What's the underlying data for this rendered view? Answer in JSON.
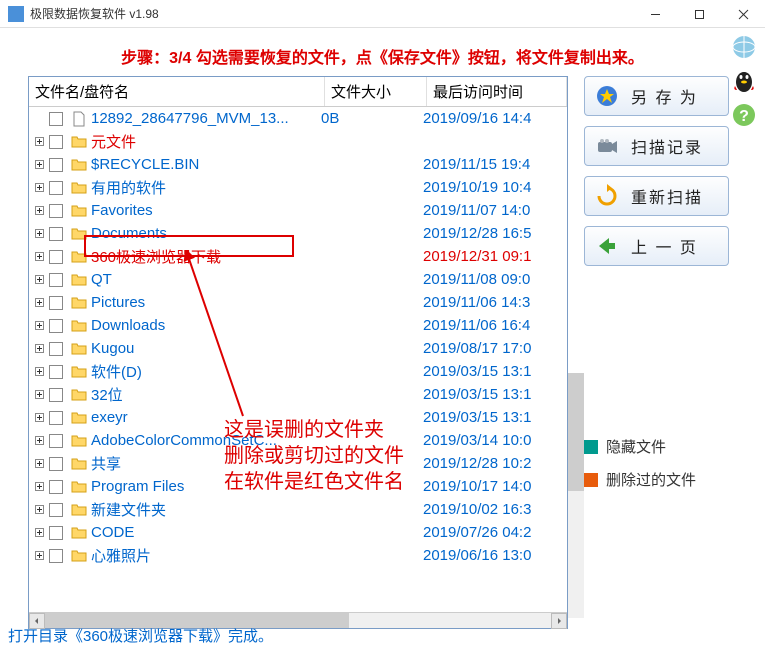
{
  "window": {
    "title": "极限数据恢复软件 v1.98"
  },
  "instruction": "步骤：3/4 勾选需要恢复的文件，点《保存文件》按钮，将文件复制出来。",
  "columns": {
    "name": "文件名/盘符名",
    "size": "文件大小",
    "date": "最后访问时间"
  },
  "rows": [
    {
      "name": "12892_28647796_MVM_13...",
      "size": "0B",
      "date": "2019/09/16 14:4",
      "type": "file",
      "deleted": false,
      "expandable": false
    },
    {
      "name": "元文件",
      "size": "",
      "date": "",
      "type": "folder",
      "deleted": true,
      "expandable": true
    },
    {
      "name": "$RECYCLE.BIN",
      "size": "",
      "date": "2019/11/15 19:4",
      "type": "folder",
      "deleted": false,
      "expandable": true
    },
    {
      "name": "有用的软件",
      "size": "",
      "date": "2019/10/19 10:4",
      "type": "folder",
      "deleted": false,
      "expandable": true
    },
    {
      "name": "Favorites",
      "size": "",
      "date": "2019/11/07 14:0",
      "type": "folder",
      "deleted": false,
      "expandable": true
    },
    {
      "name": "Documents",
      "size": "",
      "date": "2019/12/28 16:5",
      "type": "folder",
      "deleted": false,
      "expandable": true
    },
    {
      "name": "360极速浏览器下载",
      "size": "",
      "date": "2019/12/31 09:1",
      "type": "folder",
      "deleted": true,
      "expandable": true
    },
    {
      "name": "QT",
      "size": "",
      "date": "2019/11/08 09:0",
      "type": "folder",
      "deleted": false,
      "expandable": true
    },
    {
      "name": "Pictures",
      "size": "",
      "date": "2019/11/06 14:3",
      "type": "folder",
      "deleted": false,
      "expandable": true
    },
    {
      "name": "Downloads",
      "size": "",
      "date": "2019/11/06 16:4",
      "type": "folder",
      "deleted": false,
      "expandable": true
    },
    {
      "name": "Kugou",
      "size": "",
      "date": "2019/08/17 17:0",
      "type": "folder",
      "deleted": false,
      "expandable": true
    },
    {
      "name": "软件(D)",
      "size": "",
      "date": "2019/03/15 13:1",
      "type": "folder",
      "deleted": false,
      "expandable": true
    },
    {
      "name": "32位",
      "size": "",
      "date": "2019/03/15 13:1",
      "type": "folder",
      "deleted": false,
      "expandable": true
    },
    {
      "name": "exeyr",
      "size": "",
      "date": "2019/03/15 13:1",
      "type": "folder",
      "deleted": false,
      "expandable": true
    },
    {
      "name": "AdobeColorCommonSetC...",
      "size": "",
      "date": "2019/03/14 10:0",
      "type": "folder",
      "deleted": false,
      "expandable": true
    },
    {
      "name": "共享",
      "size": "",
      "date": "2019/12/28 10:2",
      "type": "folder",
      "deleted": false,
      "expandable": true
    },
    {
      "name": "Program Files",
      "size": "",
      "date": "2019/10/17 14:0",
      "type": "folder",
      "deleted": false,
      "expandable": true
    },
    {
      "name": "新建文件夹",
      "size": "",
      "date": "2019/10/02 16:3",
      "type": "folder",
      "deleted": false,
      "expandable": true
    },
    {
      "name": "CODE",
      "size": "",
      "date": "2019/07/26 04:2",
      "type": "folder",
      "deleted": false,
      "expandable": true
    },
    {
      "name": "心雅照片",
      "size": "",
      "date": "2019/06/16 13:0",
      "type": "folder",
      "deleted": false,
      "expandable": true
    }
  ],
  "annotation": {
    "line1": "这是误删的文件夹",
    "line2": "删除或剪切过的文件",
    "line3": "在软件是红色文件名"
  },
  "buttons": {
    "save": "另 存 为",
    "scanlog": "扫描记录",
    "rescan": "重新扫描",
    "prev": "上 一 页"
  },
  "legend": {
    "hidden": {
      "label": "隐藏文件",
      "color": "#009a8e"
    },
    "deleted": {
      "label": "删除过的文件",
      "color": "#e85c0c"
    }
  },
  "status": "打开目录《360极速浏览器下载》完成。"
}
